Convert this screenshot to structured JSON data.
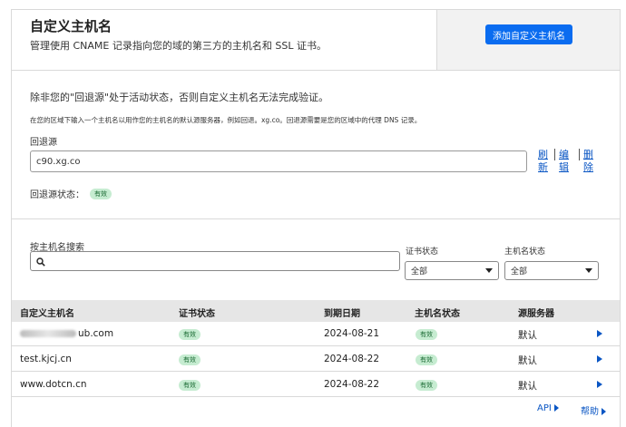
{
  "header": {
    "title": "自定义主机名",
    "description": "管理使用 CNAME 记录指向您的域的第三方的主机名和 SSL 证书。",
    "add_button": "添加自定义主机名"
  },
  "origin": {
    "warning": "除非您的\"回退源\"处于活动状态，否则自定义主机名无法完成验证。",
    "description": "在您的区域下输入一个主机名以用作您的主机名的默认源服务器，例如回退。xg.co。回退源需要是您的区域中的代理 DNS 记录。",
    "label": "回退源",
    "value": "c90.xg.co",
    "actions": [
      {
        "line1": "刷",
        "line2": "新"
      },
      {
        "line1": "编",
        "line2": "辑"
      },
      {
        "line1": "删",
        "line2": "除"
      }
    ],
    "status_label": "回退源状态：",
    "status_value": "有效"
  },
  "search": {
    "label": "按主机名搜索",
    "placeholder": "",
    "cert_status_label": "证书状态",
    "cert_status_value": "全部",
    "host_status_label": "主机名状态",
    "host_status_value": "全部"
  },
  "table": {
    "columns": [
      "自定义主机名",
      "证书状态",
      "到期日期",
      "主机名状态",
      "源服务器"
    ],
    "rows": [
      {
        "hostname_visible": "ub.com",
        "cert_status": "有效",
        "expiry": "2024-08-21",
        "host_status": "有效",
        "origin": "默认"
      },
      {
        "hostname": "test.kjcj.cn",
        "cert_status": "有效",
        "expiry": "2024-08-22",
        "host_status": "有效",
        "origin": "默认"
      },
      {
        "hostname": "www.dotcn.cn",
        "cert_status": "有效",
        "expiry": "2024-08-22",
        "host_status": "有效",
        "origin": "默认"
      }
    ]
  },
  "footer": {
    "api_link": "API",
    "help_link": "帮助"
  },
  "colors": {
    "accent": "#0a6cf0",
    "link": "#0a56c4",
    "badge_bg": "#c6ecd1",
    "badge_text": "#1a6a33",
    "table_header_bg": "#e6e6e6"
  }
}
